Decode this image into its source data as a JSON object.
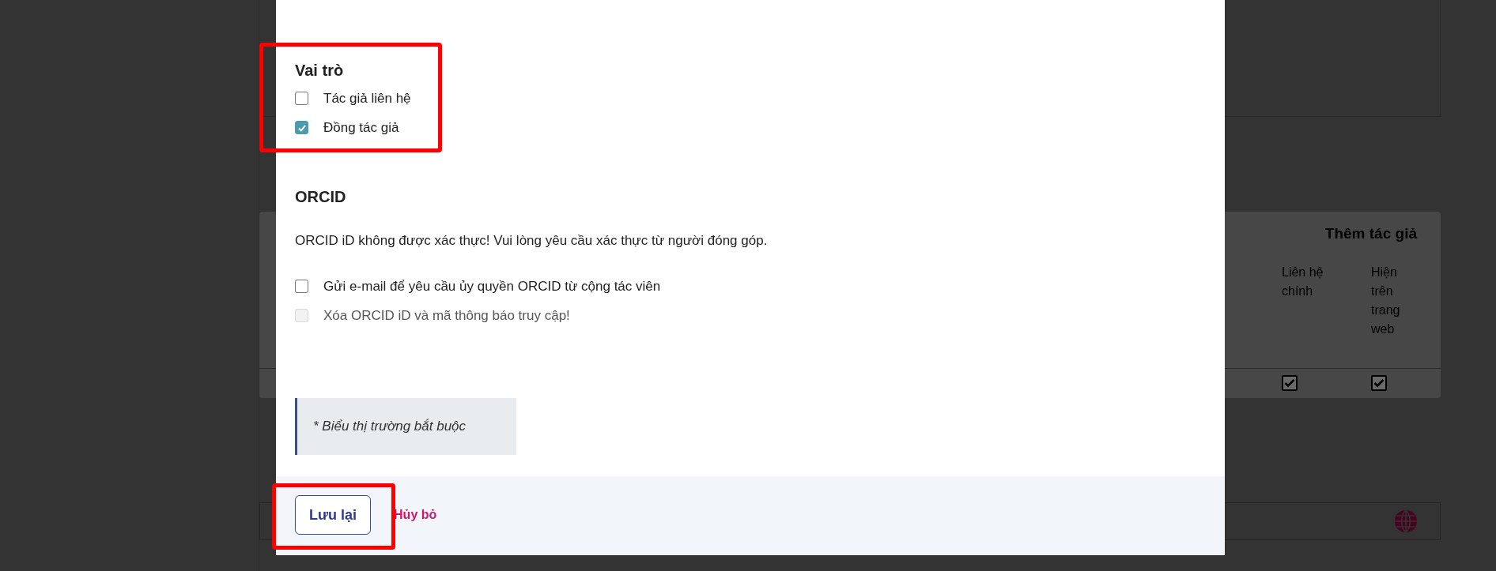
{
  "role_section": {
    "title": "Vai trò",
    "options": [
      {
        "label": "Tác giả liên hệ",
        "checked": false
      },
      {
        "label": "Đồng tác giả",
        "checked": true
      }
    ]
  },
  "orcid_section": {
    "title": "ORCID",
    "message": "ORCID iD không được xác thực! Vui lòng yêu cầu xác thực từ người đóng góp.",
    "options": [
      {
        "label": "Gửi e-mail để yêu cầu ủy quyền ORCID từ cộng tác viên",
        "checked": false,
        "disabled": false
      },
      {
        "label": "Xóa ORCID iD và mã thông báo truy cập!",
        "checked": false,
        "disabled": true
      }
    ]
  },
  "required_note": "* Biểu thị trường bắt buộc",
  "footer": {
    "save_button": "Lưu lại",
    "cancel_link": "Hủy bỏ"
  },
  "background": {
    "table": {
      "title": "Thêm tác giả",
      "columns": [
        "Liên hệ chính",
        "Hiện trên trang web"
      ],
      "rows": [
        {
          "cells": [
            {
              "checked": true
            },
            {
              "checked": true
            }
          ]
        }
      ]
    }
  }
}
